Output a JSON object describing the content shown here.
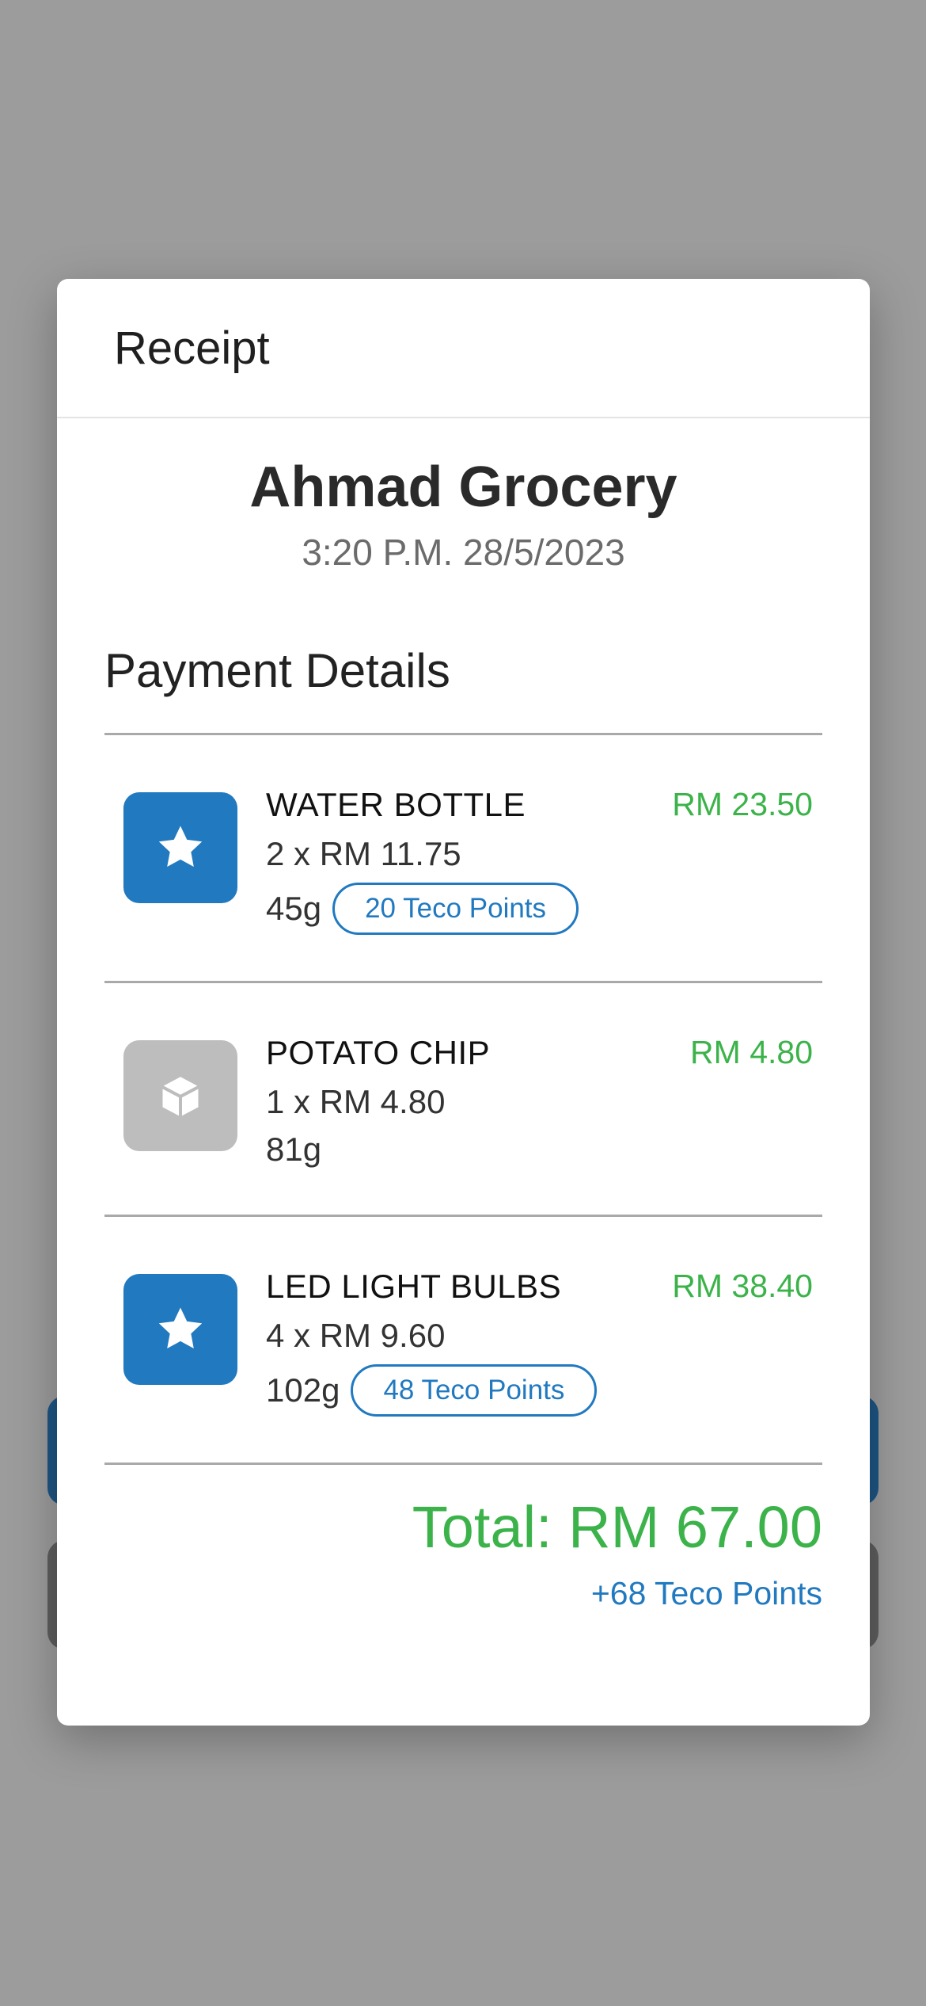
{
  "modal": {
    "title": "Receipt"
  },
  "store": {
    "name": "Ahmad Grocery",
    "datetime": "3:20 P.M. 28/5/2023"
  },
  "payment": {
    "section_title": "Payment Details",
    "items": [
      {
        "name": "WATER BOTTLE",
        "qty": "2 x RM 11.75",
        "weight": "45g",
        "points": "20 Teco Points",
        "price": "RM 23.50",
        "icon": "star-icon",
        "icon_color": "#2179c0"
      },
      {
        "name": "POTATO CHIP",
        "qty": "1 x RM 4.80",
        "weight": "81g",
        "points": "",
        "price": "RM 4.80",
        "icon": "box-icon",
        "icon_color": "#bdbdbd"
      },
      {
        "name": "LED LIGHT BULBS",
        "qty": "4 x RM 9.60",
        "weight": "102g",
        "points": "48 Teco Points",
        "price": "RM 38.40",
        "icon": "star-icon",
        "icon_color": "#2179c0"
      }
    ],
    "total": "Total: RM 67.00",
    "total_points": "+68 Teco Points"
  },
  "colors": {
    "accent_blue": "#2179c0",
    "price_green": "#3cb34a",
    "overlay": "#9c9c9c"
  }
}
